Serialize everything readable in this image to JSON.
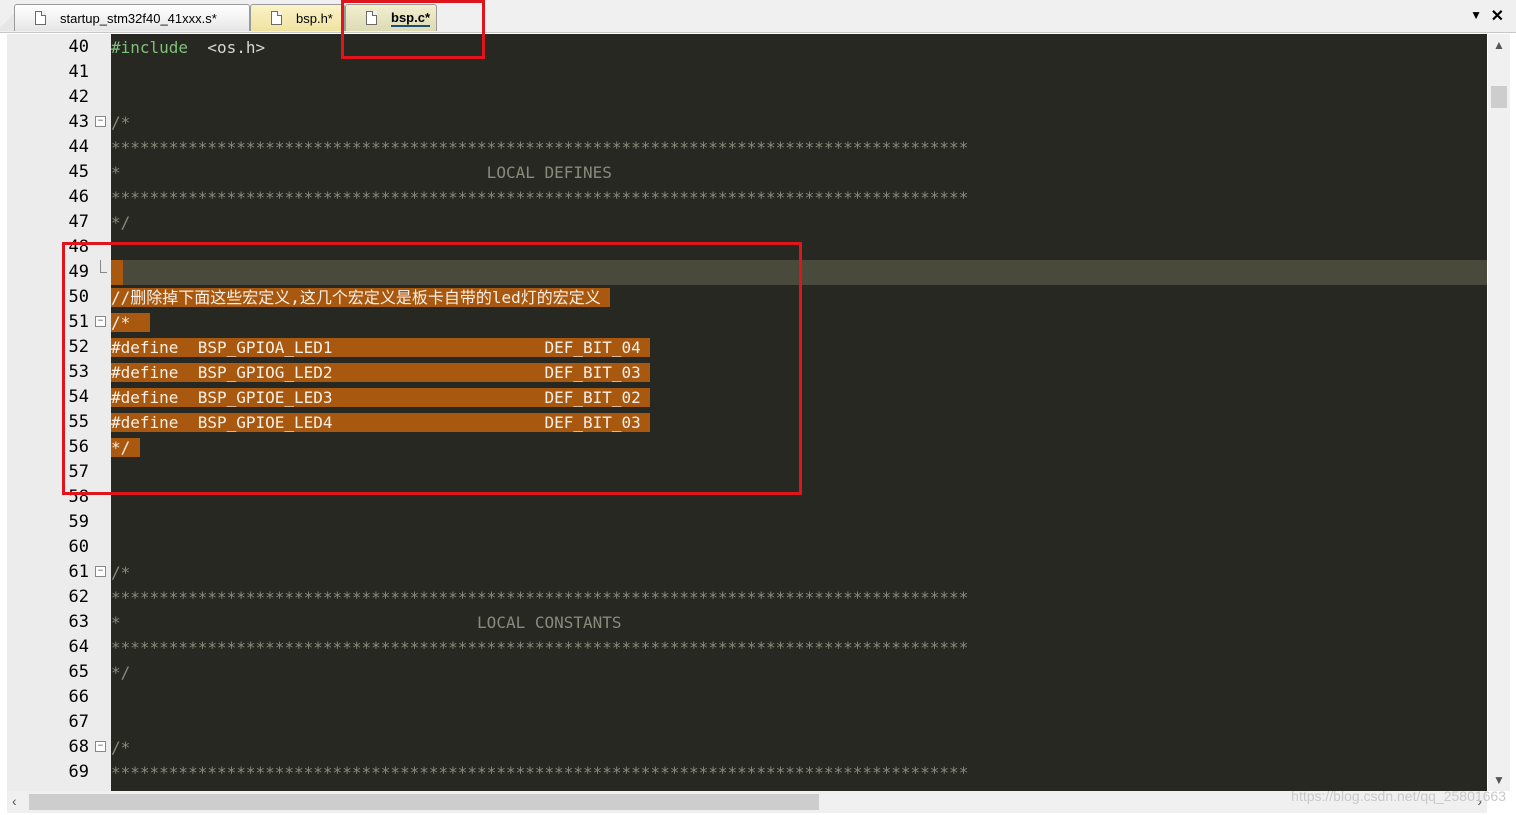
{
  "tabs": [
    {
      "label": "startup_stm32f40_41xxx.s*"
    },
    {
      "label": "bsp.h*"
    },
    {
      "label": "bsp.c*"
    }
  ],
  "tabbar": {
    "menu_glyph": "▼",
    "close_glyph": "✕"
  },
  "lines": [
    {
      "n": "40",
      "parts": [
        {
          "t": "#include",
          "c": "kw"
        },
        {
          "t": "  <os.h>",
          "c": "inc"
        }
      ]
    },
    {
      "n": "41",
      "parts": []
    },
    {
      "n": "42",
      "parts": []
    },
    {
      "n": "43",
      "fold": "open",
      "parts": [
        {
          "t": "/*",
          "c": "cmt"
        }
      ]
    },
    {
      "n": "44",
      "parts": [
        {
          "t": "*****************************************************************************************",
          "c": "cmt"
        }
      ]
    },
    {
      "n": "45",
      "parts": [
        {
          "t": "*                                      LOCAL DEFINES",
          "c": "cmt"
        }
      ]
    },
    {
      "n": "46",
      "parts": [
        {
          "t": "*****************************************************************************************",
          "c": "cmt"
        }
      ]
    },
    {
      "n": "47",
      "parts": [
        {
          "t": "*/",
          "c": "cmt"
        }
      ]
    },
    {
      "n": "48",
      "parts": []
    },
    {
      "n": "49",
      "fold": "end",
      "parts": []
    },
    {
      "n": "50",
      "parts": [
        {
          "t": "//删除掉下面这些宏定义,这几个宏定义是板卡自带的led灯的宏定义 ",
          "c": "sel"
        }
      ]
    },
    {
      "n": "51",
      "fold": "open",
      "parts": [
        {
          "t": "/*  ",
          "c": "sel"
        }
      ]
    },
    {
      "n": "52",
      "parts": [
        {
          "t": "#define  BSP_GPIOA_LED1                      DEF_BIT_04 ",
          "c": "sel"
        }
      ]
    },
    {
      "n": "53",
      "parts": [
        {
          "t": "#define  BSP_GPIOG_LED2                      DEF_BIT_03 ",
          "c": "sel"
        }
      ]
    },
    {
      "n": "54",
      "parts": [
        {
          "t": "#define  BSP_GPIOE_LED3                      DEF_BIT_02 ",
          "c": "sel"
        }
      ]
    },
    {
      "n": "55",
      "parts": [
        {
          "t": "#define  BSP_GPIOE_LED4                      DEF_BIT_03 ",
          "c": "sel"
        }
      ]
    },
    {
      "n": "56",
      "parts": [
        {
          "t": "*/ ",
          "c": "sel"
        }
      ]
    },
    {
      "n": "57",
      "parts": []
    },
    {
      "n": "58",
      "parts": []
    },
    {
      "n": "59",
      "parts": []
    },
    {
      "n": "60",
      "parts": []
    },
    {
      "n": "61",
      "fold": "open",
      "parts": [
        {
          "t": "/*",
          "c": "cmt"
        }
      ]
    },
    {
      "n": "62",
      "parts": [
        {
          "t": "*****************************************************************************************",
          "c": "cmt"
        }
      ]
    },
    {
      "n": "63",
      "parts": [
        {
          "t": "*                                     LOCAL CONSTANTS",
          "c": "cmt"
        }
      ]
    },
    {
      "n": "64",
      "parts": [
        {
          "t": "*****************************************************************************************",
          "c": "cmt"
        }
      ]
    },
    {
      "n": "65",
      "parts": [
        {
          "t": "*/",
          "c": "cmt"
        }
      ]
    },
    {
      "n": "66",
      "parts": []
    },
    {
      "n": "67",
      "parts": []
    },
    {
      "n": "68",
      "fold": "open",
      "parts": [
        {
          "t": "/*",
          "c": "cmt"
        }
      ]
    },
    {
      "n": "69",
      "parts": [
        {
          "t": "*****************************************************************************************",
          "c": "cmt"
        }
      ]
    }
  ],
  "watermark": "https://blog.csdn.net/qq_25801663",
  "colors": {
    "editor_bg": "#272822",
    "selection": "#a8580f",
    "annotation_red": "#e0141b",
    "keyword": "#7ec27a"
  },
  "icons": [
    "document-icon",
    "dropdown-arrow-icon",
    "close-icon",
    "fold-toggle-icon",
    "scroll-up-icon",
    "scroll-down-icon",
    "scroll-left-icon",
    "scroll-right-icon"
  ]
}
